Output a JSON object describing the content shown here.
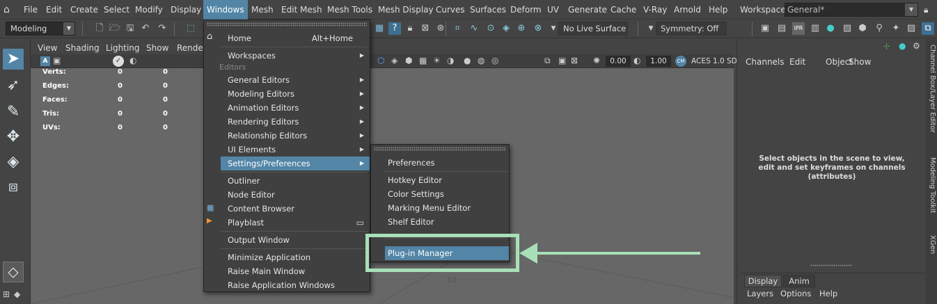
{
  "menubar": {
    "items": [
      "File",
      "Edit",
      "Create",
      "Select",
      "Modify",
      "Display",
      "Windows",
      "Mesh",
      "Edit Mesh",
      "Mesh Tools",
      "Mesh Display",
      "Curves",
      "Surfaces",
      "Deform",
      "UV",
      "Generate",
      "Cache",
      "V-Ray",
      "Arnold",
      "Help"
    ],
    "workspace_label": "Workspace:",
    "workspace_value": "General*"
  },
  "toolbar": {
    "mode": "Modeling",
    "live_surface": "No Live Surface",
    "symmetry": "Symmetry: Off"
  },
  "viewport": {
    "menu": [
      "View",
      "Shading",
      "Lighting",
      "Show",
      "Render"
    ],
    "exposure": "0.00",
    "gamma": "1.00",
    "color_space": "ACES 1.0 SD",
    "hud_rows": [
      {
        "label": "Verts:",
        "a": "0",
        "b": "0"
      },
      {
        "label": "Edges:",
        "a": "0",
        "b": "0"
      },
      {
        "label": "Faces:",
        "a": "0",
        "b": "0"
      },
      {
        "label": "Tris:",
        "a": "0",
        "b": "0"
      },
      {
        "label": "UVs:",
        "a": "0",
        "b": "0"
      }
    ],
    "grid_label": "10"
  },
  "windows_menu": {
    "home": "Home",
    "home_shortcut": "Alt+Home",
    "workspaces": "Workspaces",
    "section_editors": "Editors",
    "items": [
      "General Editors",
      "Modeling Editors",
      "Animation Editors",
      "Rendering Editors",
      "Relationship Editors",
      "UI Elements",
      "Settings/Preferences"
    ],
    "items2": [
      "Outliner",
      "Node Editor",
      "Content Browser",
      "Playblast"
    ],
    "items3": [
      "Output Window"
    ],
    "items4": [
      "Minimize Application",
      "Raise Main Window",
      "Raise Application Windows"
    ]
  },
  "settings_submenu": {
    "items": [
      "Preferences",
      "Hotkey Editor",
      "Color Settings",
      "Marking Menu Editor",
      "Shelf Editor",
      "Plug-in Manager"
    ]
  },
  "channel_box": {
    "menu": [
      "Channels",
      "Edit",
      "Object",
      "Show"
    ],
    "message": "Select objects in the scene to view, edit and set keyframes on channels (attributes)"
  },
  "layer_editor": {
    "tabs": [
      "Display",
      "Anim"
    ],
    "menu": [
      "Layers",
      "Options",
      "Help"
    ]
  },
  "side_tabs": [
    "Channel Box/Layer Editor",
    "Modeling Toolkit",
    "XGen"
  ],
  "colors": {
    "highlight": "#5285a6",
    "annotation": "#a8e0b8"
  }
}
